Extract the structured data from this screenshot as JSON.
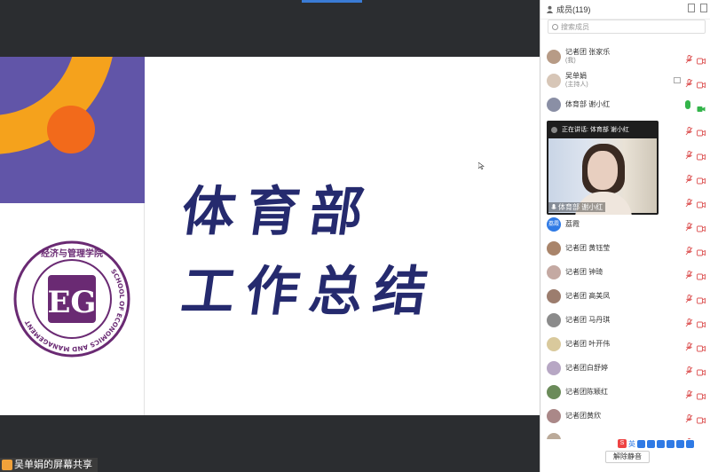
{
  "share": {
    "title_line1": "体育部",
    "title_line2": "工作总结",
    "logo_top": "经济与管理学院",
    "logo_ring": "SCHOOL OF ECONOMICS AND MANAGEMENT",
    "share_tag": "吴单娟的屏幕共享"
  },
  "panel": {
    "title": "成员(119)",
    "search_placeholder": "搜索成员",
    "members": [
      {
        "name": "记者团 张家乐",
        "sub": "(我)",
        "mic": "off",
        "cam": "off",
        "avatar_color": "#b79b86"
      },
      {
        "name": "吴单娟",
        "sub": "(主持人)",
        "mic": "off",
        "cam": "off",
        "host": true,
        "avatar_color": "#d7c6b7"
      },
      {
        "name": "体育部 谢小红",
        "sub": "",
        "mic": "on",
        "cam": "on",
        "avatar_color": "#8a8fa5"
      },
      {
        "name": "",
        "sub": "",
        "mic": "off",
        "cam": "off",
        "avatar_color": "#cbb"
      },
      {
        "name": "",
        "sub": "",
        "mic": "off",
        "cam": "off",
        "avatar_color": "#cbb"
      },
      {
        "name": "",
        "sub": "",
        "mic": "off",
        "cam": "off",
        "avatar_color": "#cbb"
      },
      {
        "name": "",
        "sub": "",
        "mic": "off",
        "cam": "off",
        "avatar_color": "#cbb"
      },
      {
        "name": "荔霞",
        "sub": "",
        "mic": "off",
        "cam": "off",
        "avatar_text": "荔霞",
        "avatar_color": "#2f7ae5"
      },
      {
        "name": "记者团 黄钰莹",
        "sub": "",
        "mic": "off",
        "cam": "off",
        "avatar_color": "#a9846a"
      },
      {
        "name": "记者团 钟琦",
        "sub": "",
        "mic": "off",
        "cam": "off",
        "avatar_color": "#c4a9a2"
      },
      {
        "name": "记者团 高美凤",
        "sub": "",
        "mic": "off",
        "cam": "off",
        "avatar_color": "#9c7d6e"
      },
      {
        "name": "记者团 马丹琪",
        "sub": "",
        "mic": "off",
        "cam": "off",
        "avatar_color": "#8b8b8b"
      },
      {
        "name": "记者团 叶开伟",
        "sub": "",
        "mic": "off",
        "cam": "off",
        "avatar_color": "#d9c99c"
      },
      {
        "name": "记者团白舒婷",
        "sub": "",
        "mic": "off",
        "cam": "off",
        "avatar_color": "#b7a7c4"
      },
      {
        "name": "记者团陈颖红",
        "sub": "",
        "mic": "off",
        "cam": "off",
        "avatar_color": "#6b8b5a"
      },
      {
        "name": "记者团黄欣",
        "sub": "",
        "mic": "off",
        "cam": "off",
        "avatar_color": "#a88"
      },
      {
        "name": "",
        "sub": "",
        "mic": "off",
        "cam": "off",
        "avatar_color": "#ba9"
      }
    ],
    "video_speaking": "正在讲话: 体育部 谢小红",
    "video_label": "体育部 谢小红",
    "toolbar_lang": "英",
    "unmute_button": "解除静音"
  },
  "colors": {
    "purple": "#6155a8",
    "orange_arc": "#f5a21c",
    "orange_dot": "#f26a1b",
    "title_navy": "#252a6e",
    "accent_blue": "#2f7ae5",
    "mic_green": "#33b44a"
  }
}
